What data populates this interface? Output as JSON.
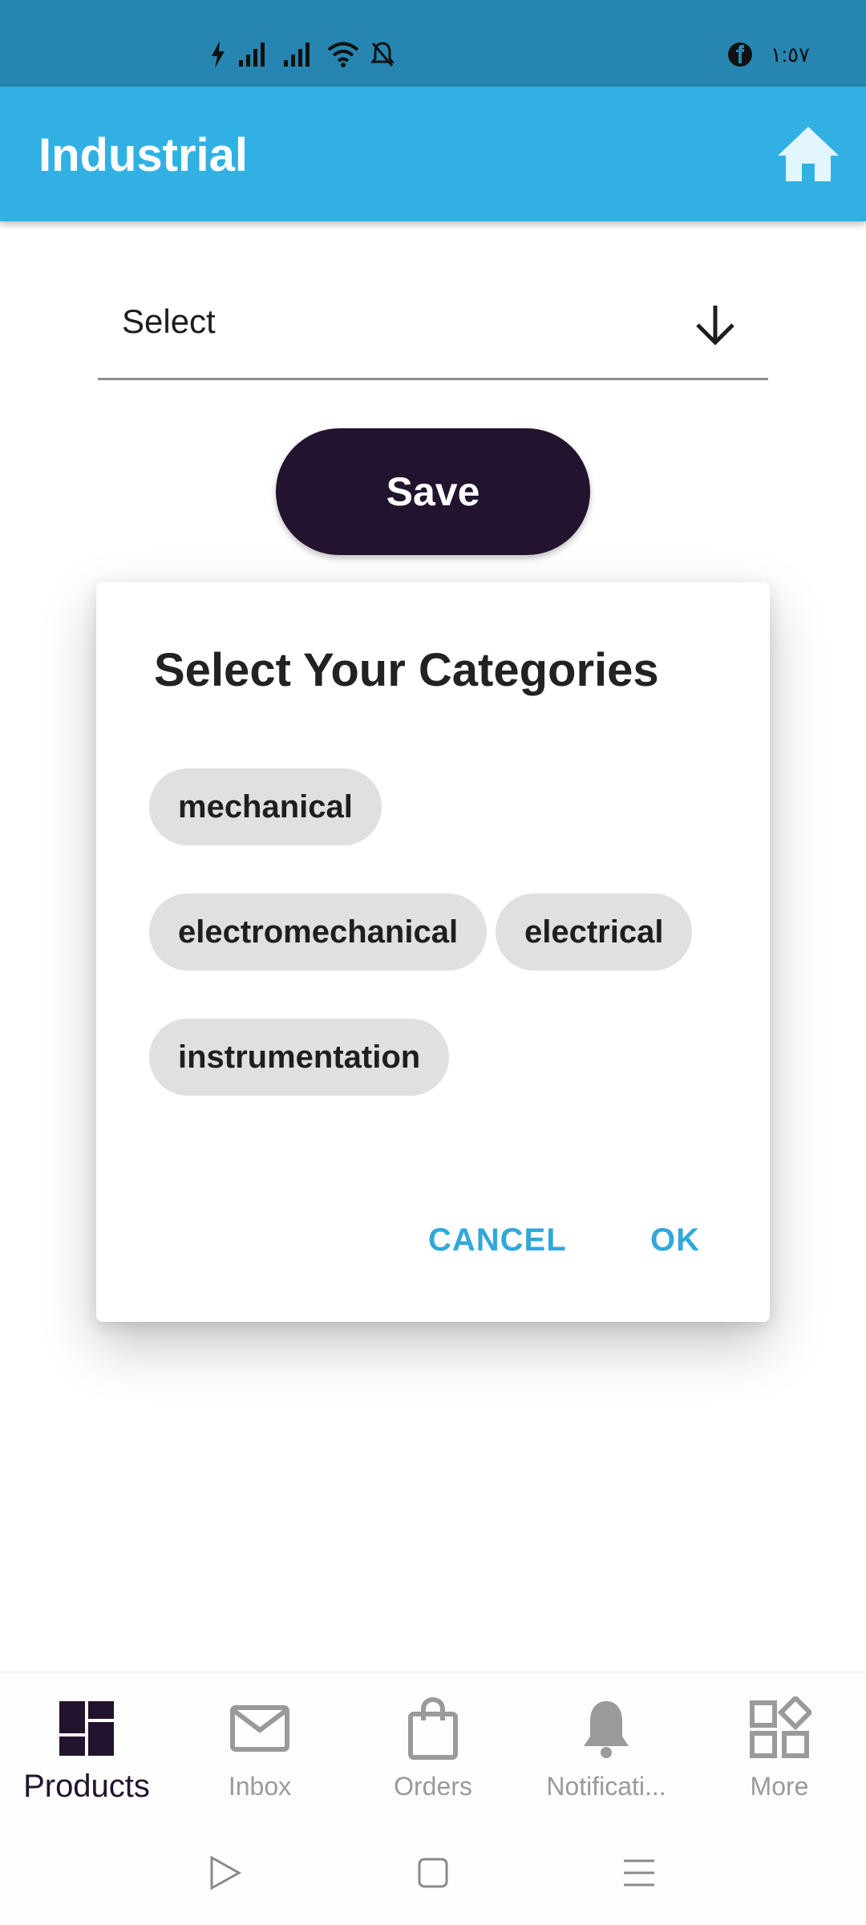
{
  "status_bar": {
    "time": "١:٥٧",
    "icons": [
      "charging-bolt-icon",
      "signal-icon",
      "signal-icon",
      "wifi-icon",
      "bell-muted-icon",
      "facebook-icon"
    ]
  },
  "app_bar": {
    "title": "Industrial",
    "home_icon": "home-icon"
  },
  "form": {
    "select_label": "Select",
    "save_label": "Save"
  },
  "dialog": {
    "title": "Select Your Categories",
    "chips": [
      "mechanical",
      "electromechanical",
      "electrical",
      "instrumentation"
    ],
    "cancel_label": "CANCEL",
    "ok_label": "OK"
  },
  "bottom_nav": {
    "items": [
      {
        "label": "Products",
        "icon": "dashboard-icon",
        "active": true
      },
      {
        "label": "Inbox",
        "icon": "mail-icon",
        "active": false
      },
      {
        "label": "Orders",
        "icon": "shopping-bag-icon",
        "active": false
      },
      {
        "label": "Notificati...",
        "icon": "bell-icon",
        "active": false
      },
      {
        "label": "More",
        "icon": "widgets-icon",
        "active": false
      }
    ]
  },
  "colors": {
    "status_bar": "#2686b1",
    "app_bar": "#31b1e3",
    "primary_dark": "#22132e",
    "accent": "#31a8db",
    "chip_bg": "#e0e0e0"
  }
}
